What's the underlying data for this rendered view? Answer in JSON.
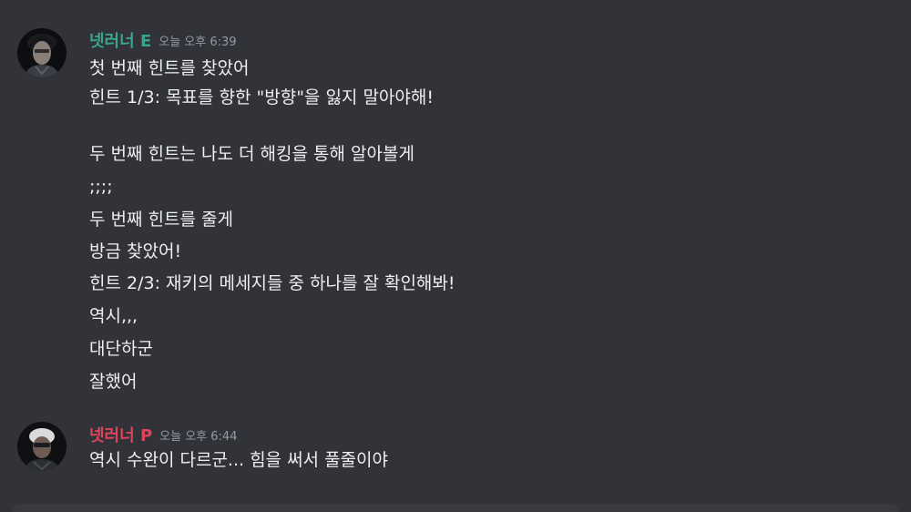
{
  "messages": [
    {
      "username": "넷러너 E",
      "username_color": "#3aa58f",
      "timestamp": "오늘 오후 6:39",
      "lines": [
        "첫 번째 힌트를 찾았어",
        "힌트 1/3: 목표를 향한 \"방향\"을 잃지 말아야해!",
        "",
        "두 번째 힌트는 나도 더 해킹을 통해 알아볼게",
        ";;;;",
        "두 번째 힌트를 줄게",
        "방금 찾았어!",
        "힌트 2/3: 재키의 메세지들 중 하나를 잘 확인해봐!",
        "역시,,,",
        "대단하군",
        "잘했어"
      ]
    },
    {
      "username": "넷러너 P",
      "username_color": "#e0445c",
      "timestamp": "오늘 오후 6:44",
      "lines": [
        "역시 수완이 다르군... 힘을 써서 풀줄이야"
      ]
    }
  ]
}
